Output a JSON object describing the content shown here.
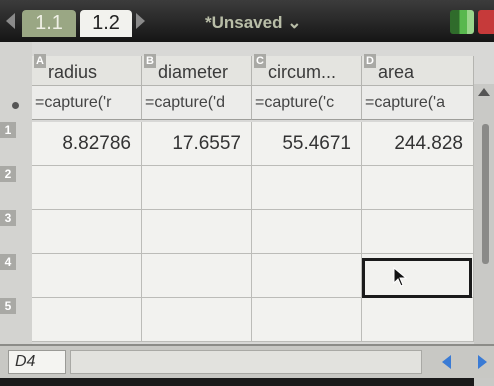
{
  "tabs": [
    {
      "label": "1.1"
    },
    {
      "label": "1.2"
    }
  ],
  "document": {
    "title": "*Unsaved ⌄"
  },
  "columns": [
    {
      "letter": "A",
      "name": "radius",
      "formula": "=capture('r"
    },
    {
      "letter": "B",
      "name": "diameter",
      "formula": "=capture('d"
    },
    {
      "letter": "C",
      "name": "circum...",
      "formula": "=capture('c"
    },
    {
      "letter": "D",
      "name": "area",
      "formula": "=capture('a"
    }
  ],
  "rows": [
    {
      "num": "1",
      "cells": [
        "8.82786",
        "17.6557",
        "55.4671",
        "244.828"
      ]
    },
    {
      "num": "2",
      "cells": [
        "",
        "",
        "",
        ""
      ]
    },
    {
      "num": "3",
      "cells": [
        "",
        "",
        "",
        ""
      ]
    },
    {
      "num": "4",
      "cells": [
        "",
        "",
        "",
        ""
      ]
    },
    {
      "num": "5",
      "cells": [
        "",
        "",
        "",
        ""
      ]
    }
  ],
  "status": {
    "cell_ref": "D4",
    "entry_value": ""
  },
  "colors": {
    "tab_active": "#f2f2ee",
    "tab_inactive": "#9aa784",
    "nav_arrows": "#3a7bd5"
  },
  "icons": [
    "tab-left-arrow-icon",
    "tab-right-arrow-icon",
    "battery-icon",
    "pointer-cursor-icon",
    "nav-left-icon",
    "nav-right-icon"
  ]
}
